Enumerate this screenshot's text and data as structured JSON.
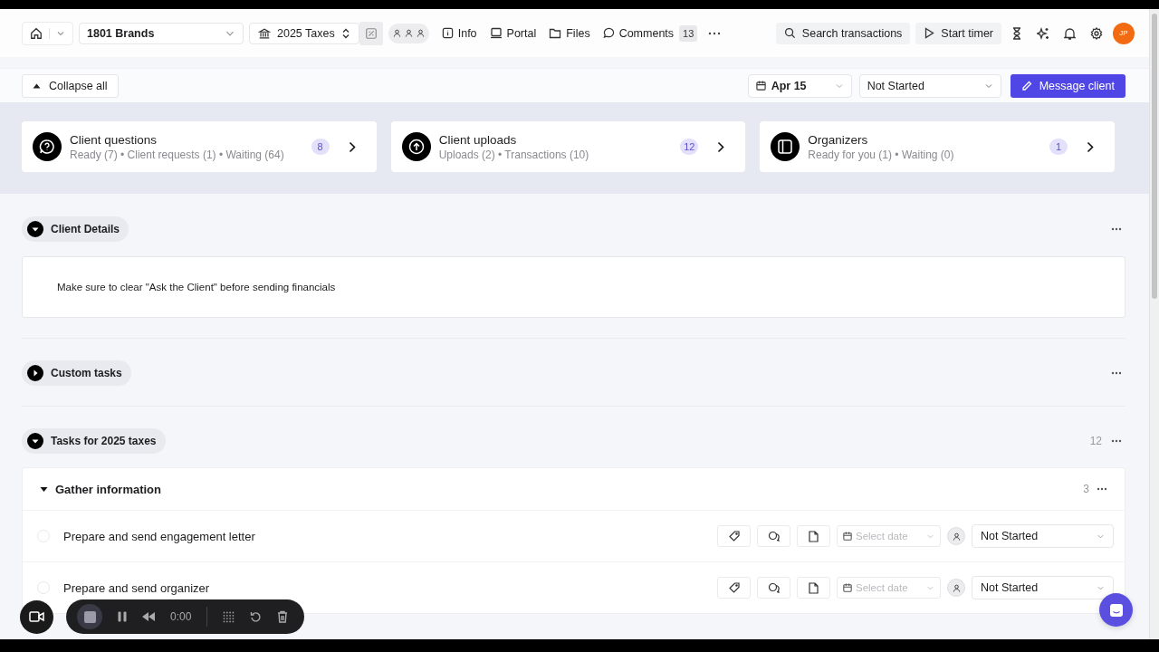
{
  "nav": {
    "client": "1801 Brands",
    "project": "2025 Taxes",
    "links": [
      {
        "label": "Info"
      },
      {
        "label": "Portal"
      },
      {
        "label": "Files"
      },
      {
        "label": "Comments",
        "count": "13"
      }
    ],
    "search": "Search transactions",
    "timer": "Start timer",
    "avatar": "JP"
  },
  "toolbar": {
    "collapse": "Collapse all",
    "due_date": "Apr 15",
    "status": "Not Started",
    "message": "Message client"
  },
  "cards": [
    {
      "title": "Client questions",
      "subtitle": "Ready (7) • Client requests (1) • Waiting (64)",
      "count": "8"
    },
    {
      "title": "Client uploads",
      "subtitle": "Uploads (2) • Transactions (10)",
      "count": "12"
    },
    {
      "title": "Organizers",
      "subtitle": "Ready for you (1) • Waiting (0)",
      "count": "1"
    }
  ],
  "sections": [
    {
      "title": "Client Details",
      "expanded": true,
      "note": "Make sure to clear \"Ask the Client\" before sending financials"
    },
    {
      "title": "Custom tasks",
      "expanded": false
    },
    {
      "title": "Tasks for 2025 taxes",
      "expanded": true,
      "count": "12",
      "groups": [
        {
          "title": "Gather information",
          "expanded": true,
          "count": "3",
          "tasks": [
            {
              "name": "Prepare and send engagement letter",
              "checked": false,
              "date_placeholder": "Select date",
              "status": "Not Started"
            },
            {
              "name": "Prepare and send organizer",
              "checked": false,
              "date_placeholder": "Select date",
              "status": "Not Started"
            }
          ]
        }
      ]
    }
  ],
  "recorder": {
    "time": "0:00"
  }
}
